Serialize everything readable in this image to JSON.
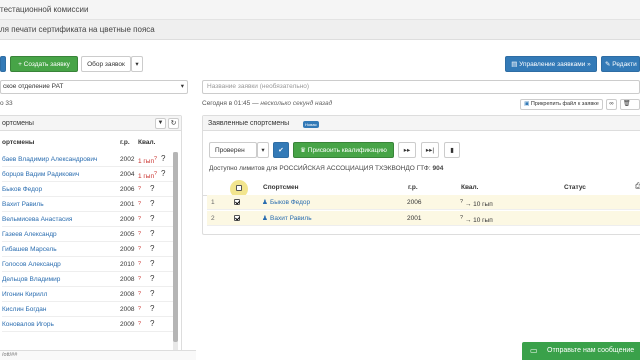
{
  "header": {
    "title": "тестационной комиссии",
    "subtitle": "ля печати сертификата на цветные пояса"
  },
  "toolbar": {
    "create_label": "Создать заявку",
    "create_icon": "plus-icon",
    "filter_label": "Обор заявок",
    "manage_label": "Управление заявками »",
    "manage_icon": "file-icon",
    "edit_label": "Редакти",
    "edit_icon": "pencil-icon"
  },
  "left_select": {
    "value": "ское отделение РАТ"
  },
  "left_count": "о 33",
  "app_name_input": {
    "placeholder": "Название заявки (необязательно)"
  },
  "timestamp": {
    "text": "Сегодня в 01:45",
    "note": "— несколько секунд назад"
  },
  "attach_label": "Прикрепить файл к заявке",
  "left_panel": {
    "title": "ортсмены",
    "col_year": "г.р.",
    "col_qual": "Квал.",
    "rows": [
      {
        "name": "баев Владимир Александрович",
        "year": "2002",
        "qual": "1 гып",
        "sup": "?"
      },
      {
        "name": "борцов Вадим Радикович",
        "year": "2004",
        "qual": "1 гып",
        "sup": "?"
      },
      {
        "name": "Быков Федор",
        "year": "2006",
        "qual": "",
        "sup": "?"
      },
      {
        "name": "Вахит Равиль",
        "year": "2001",
        "qual": "",
        "sup": "?"
      },
      {
        "name": "Вельмисева Анастасия",
        "year": "2009",
        "qual": "",
        "sup": "?"
      },
      {
        "name": "Газеев Александр",
        "year": "2005",
        "qual": "",
        "sup": "?"
      },
      {
        "name": "Гибашев Марсель",
        "year": "2009",
        "qual": "",
        "sup": "?"
      },
      {
        "name": "Голосов Александр",
        "year": "2010",
        "qual": "",
        "sup": "?"
      },
      {
        "name": "Дельцов Владимир",
        "year": "2008",
        "qual": "",
        "sup": "?"
      },
      {
        "name": "Игонин Кирилл",
        "year": "2008",
        "qual": "",
        "sup": "?"
      },
      {
        "name": "Кислин Богдан",
        "year": "2008",
        "qual": "",
        "sup": "?"
      },
      {
        "name": "Коновалов Игорь",
        "year": "2009",
        "qual": "",
        "sup": "?"
      }
    ],
    "footer_link": "/ott/##"
  },
  "right_panel": {
    "title": "Заявленные спортсмены",
    "badge": "Новая",
    "status_select": "Проверен",
    "assign_label": "Присвоить квалификацию",
    "limit_text": "Доступно лимитов для РОССИЙСКАЯ АССОЦИАЦИЯ ТХЭКВОНДО ГТФ:",
    "limit_value": "904",
    "headers": {
      "athlete": "Спортсмен",
      "year": "г.р.",
      "qual": "Квал.",
      "status": "Статус"
    },
    "rows": [
      {
        "num": "1",
        "name": "Быков Федор",
        "year": "2006",
        "qual": "→ 10 гып",
        "sup": "?"
      },
      {
        "num": "2",
        "name": "Вахит Равиль",
        "year": "2001",
        "qual": "→ 10 гып",
        "sup": "?"
      }
    ]
  },
  "chat": {
    "label": "Отправьте нам сообщение"
  }
}
